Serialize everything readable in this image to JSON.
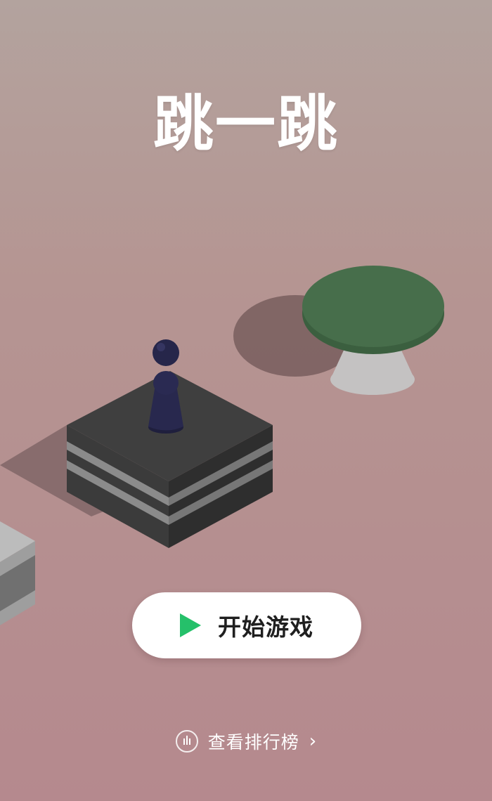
{
  "game": {
    "title": "跳一跳"
  },
  "start_button": {
    "label": "开始游戏",
    "icon": "play-icon"
  },
  "leaderboard": {
    "label": "查看排行榜",
    "icon": "leaderboard-icon",
    "trailing_icon": "chevron-right-icon"
  },
  "colors": {
    "background_top": "#b3a39e",
    "background_bottom": "#b5898e",
    "play_icon": "#25c06a",
    "platform_green": "#476e4b",
    "platform_dark": "#3a3a3a",
    "piece": "#26264a"
  }
}
